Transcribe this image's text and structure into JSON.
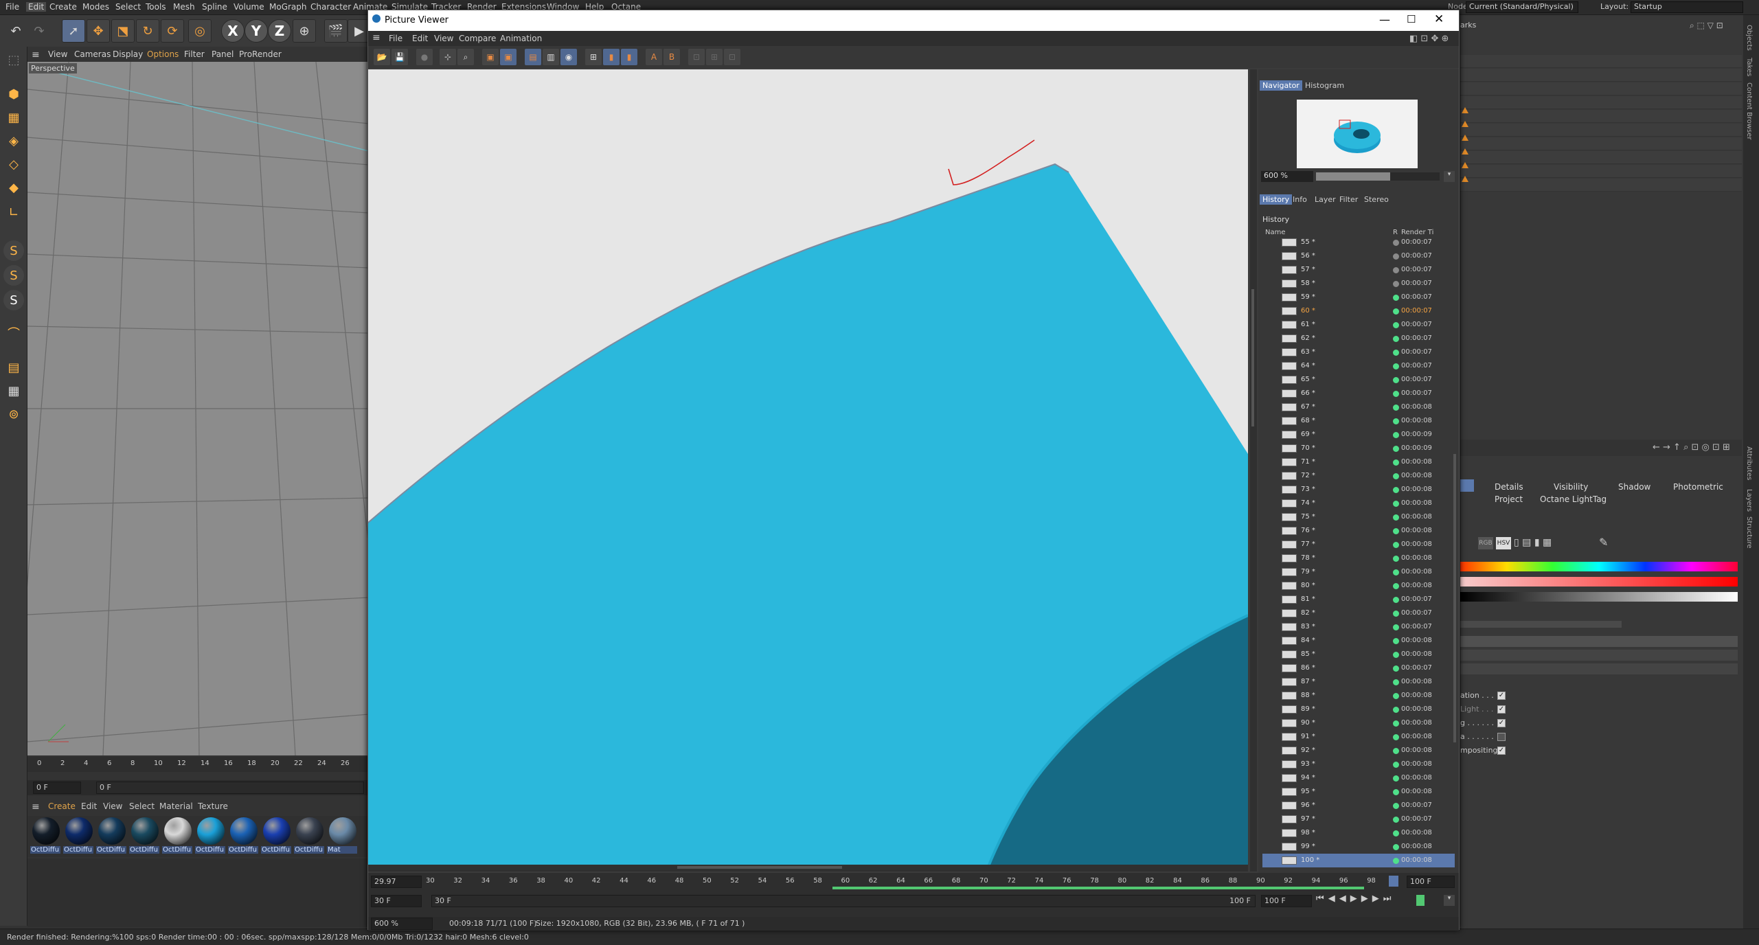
{
  "menubar": {
    "items": [
      "File",
      "Edit",
      "Create",
      "Modes",
      "Select",
      "Tools",
      "Mesh",
      "Spline",
      "Volume",
      "MoGraph",
      "Character",
      "Animate",
      "Simulate",
      "Tracker",
      "Render",
      "Extensions",
      "Window",
      "Help",
      "Octane"
    ],
    "node_space_label": "Node Space:",
    "node_space_value": "Current (Standard/Physical)",
    "layout_label": "Layout:",
    "layout_value": "Startup"
  },
  "viewport": {
    "menu": [
      "View",
      "Cameras",
      "Display",
      "Options",
      "Filter",
      "Panel",
      "ProRender"
    ],
    "label": "Perspective"
  },
  "timeline_left": {
    "ticks": [
      "0",
      "2",
      "4",
      "6",
      "8",
      "10",
      "12",
      "14",
      "16",
      "18",
      "20",
      "22",
      "24",
      "26"
    ],
    "start_field": "0 F",
    "current_field": "0 F"
  },
  "material_bar": {
    "menu": [
      "Create",
      "Edit",
      "View",
      "Select",
      "Material",
      "Texture"
    ],
    "materials": [
      {
        "name": "OctDiffu",
        "color": "#141e2a"
      },
      {
        "name": "OctDiffu",
        "color": "#0e2b6a"
      },
      {
        "name": "OctDiffu",
        "color": "#143b5c"
      },
      {
        "name": "OctDiffu",
        "color": "#1a4a60"
      },
      {
        "name": "OctDiffu",
        "color": "#d8d8d8"
      },
      {
        "name": "OctDiffu",
        "color": "#1aa0d8"
      },
      {
        "name": "OctDiffu",
        "color": "#1b62b5"
      },
      {
        "name": "OctDiffu",
        "color": "#1a3fb0"
      },
      {
        "name": "OctDiffu",
        "color": "#3a4250"
      },
      {
        "name": "Mat",
        "color": "#6a8aa8"
      }
    ]
  },
  "status": "Render finished: Rendering:%100 sps:0 Render time:00 : 00 : 06sec. spp/maxspp:128/128 Mem:0/0/0Mb Tri:0/1232 hair:0 Mesh:6 clevel:0",
  "right_panel": {
    "vertical_tabs_top": [
      "Objects",
      "Takes",
      "Content Browser"
    ],
    "vertical_tabs_bottom": [
      "Attributes",
      "Layers",
      "Structure"
    ],
    "header_fragment": "arks",
    "attr_tabs_row1": [
      "Details",
      "Visibility",
      "Shadow",
      "Photometric"
    ],
    "attr_tabs_row2": [
      "Project",
      "Octane LightTag"
    ],
    "color_modes": [
      "RGB",
      "HSV"
    ],
    "checks": [
      {
        "label": "ation . . .",
        "checked": true
      },
      {
        "label": "Light . . .",
        "checked": true
      },
      {
        "label": "g . . . . . .",
        "checked": true
      },
      {
        "label": "a . . . . . .",
        "checked": false
      },
      {
        "label": "mpositing",
        "checked": true
      }
    ]
  },
  "picture_viewer": {
    "title": "Picture Viewer",
    "menu": [
      "File",
      "Edit",
      "View",
      "Compare",
      "Animation"
    ],
    "nav_tabs": [
      "Navigator",
      "Histogram"
    ],
    "zoom": "600 %",
    "info_tabs": [
      "History",
      "Info",
      "Layer",
      "Filter",
      "Stereo"
    ],
    "history_title": "History",
    "col_name": "Name",
    "col_r": "R",
    "col_time": "Render Ti",
    "history": [
      {
        "n": "55 *",
        "t": "00:00:07",
        "s": "grey"
      },
      {
        "n": "56 *",
        "t": "00:00:07",
        "s": "grey"
      },
      {
        "n": "57 *",
        "t": "00:00:07",
        "s": "grey"
      },
      {
        "n": "58 *",
        "t": "00:00:07",
        "s": "grey"
      },
      {
        "n": "59 *",
        "t": "00:00:07",
        "s": "green"
      },
      {
        "n": "60 *",
        "t": "00:00:07",
        "s": "green",
        "cur": true
      },
      {
        "n": "61 *",
        "t": "00:00:07",
        "s": "green"
      },
      {
        "n": "62 *",
        "t": "00:00:07",
        "s": "green"
      },
      {
        "n": "63 *",
        "t": "00:00:07",
        "s": "green"
      },
      {
        "n": "64 *",
        "t": "00:00:07",
        "s": "green"
      },
      {
        "n": "65 *",
        "t": "00:00:07",
        "s": "green"
      },
      {
        "n": "66 *",
        "t": "00:00:07",
        "s": "green"
      },
      {
        "n": "67 *",
        "t": "00:00:08",
        "s": "green"
      },
      {
        "n": "68 *",
        "t": "00:00:08",
        "s": "green"
      },
      {
        "n": "69 *",
        "t": "00:00:09",
        "s": "green"
      },
      {
        "n": "70 *",
        "t": "00:00:09",
        "s": "green"
      },
      {
        "n": "71 *",
        "t": "00:00:08",
        "s": "green"
      },
      {
        "n": "72 *",
        "t": "00:00:08",
        "s": "green"
      },
      {
        "n": "73 *",
        "t": "00:00:08",
        "s": "green"
      },
      {
        "n": "74 *",
        "t": "00:00:08",
        "s": "green"
      },
      {
        "n": "75 *",
        "t": "00:00:08",
        "s": "green"
      },
      {
        "n": "76 *",
        "t": "00:00:08",
        "s": "green"
      },
      {
        "n": "77 *",
        "t": "00:00:08",
        "s": "green"
      },
      {
        "n": "78 *",
        "t": "00:00:08",
        "s": "green"
      },
      {
        "n": "79 *",
        "t": "00:00:08",
        "s": "green"
      },
      {
        "n": "80 *",
        "t": "00:00:08",
        "s": "green"
      },
      {
        "n": "81 *",
        "t": "00:00:07",
        "s": "green"
      },
      {
        "n": "82 *",
        "t": "00:00:07",
        "s": "green"
      },
      {
        "n": "83 *",
        "t": "00:00:07",
        "s": "green"
      },
      {
        "n": "84 *",
        "t": "00:00:08",
        "s": "green"
      },
      {
        "n": "85 *",
        "t": "00:00:08",
        "s": "green"
      },
      {
        "n": "86 *",
        "t": "00:00:07",
        "s": "green"
      },
      {
        "n": "87 *",
        "t": "00:00:08",
        "s": "green"
      },
      {
        "n": "88 *",
        "t": "00:00:08",
        "s": "green"
      },
      {
        "n": "89 *",
        "t": "00:00:08",
        "s": "green"
      },
      {
        "n": "90 *",
        "t": "00:00:08",
        "s": "green"
      },
      {
        "n": "91 *",
        "t": "00:00:08",
        "s": "green"
      },
      {
        "n": "92 *",
        "t": "00:00:08",
        "s": "green"
      },
      {
        "n": "93 *",
        "t": "00:00:08",
        "s": "green"
      },
      {
        "n": "94 *",
        "t": "00:00:08",
        "s": "green"
      },
      {
        "n": "95 *",
        "t": "00:00:08",
        "s": "green"
      },
      {
        "n": "96 *",
        "t": "00:00:07",
        "s": "green"
      },
      {
        "n": "97 *",
        "t": "00:00:07",
        "s": "green"
      },
      {
        "n": "98 *",
        "t": "00:00:08",
        "s": "green"
      },
      {
        "n": "99 *",
        "t": "00:00:08",
        "s": "green"
      },
      {
        "n": "100 *",
        "t": "00:00:08",
        "s": "green",
        "sel": true
      }
    ],
    "timeline": {
      "fps": "29.97",
      "ticks": [
        "30",
        "32",
        "34",
        "36",
        "38",
        "40",
        "42",
        "44",
        "46",
        "48",
        "50",
        "52",
        "54",
        "56",
        "58",
        "60",
        "62",
        "64",
        "66",
        "68",
        "70",
        "72",
        "74",
        "76",
        "78",
        "80",
        "82",
        "84",
        "86",
        "88",
        "90",
        "92",
        "94",
        "96",
        "98"
      ],
      "end": "100 F",
      "start_field": "30 F",
      "range_start": "30 F",
      "range_end": "100 F",
      "end_field": "100 F"
    },
    "status_zoom": "600 %",
    "status_time": "00:09:18 71/71 (100 F)",
    "status_size": "Size: 1920x1080, RGB (32 Bit), 23.96 MB,  ( F 71 of 71 )"
  },
  "colors": {
    "accent": "#5b79ad",
    "render_cyan": "#2bb8dc",
    "render_dark": "#166a85",
    "render_bg": "#e6e6e6",
    "annotation_red": "#d32020"
  }
}
